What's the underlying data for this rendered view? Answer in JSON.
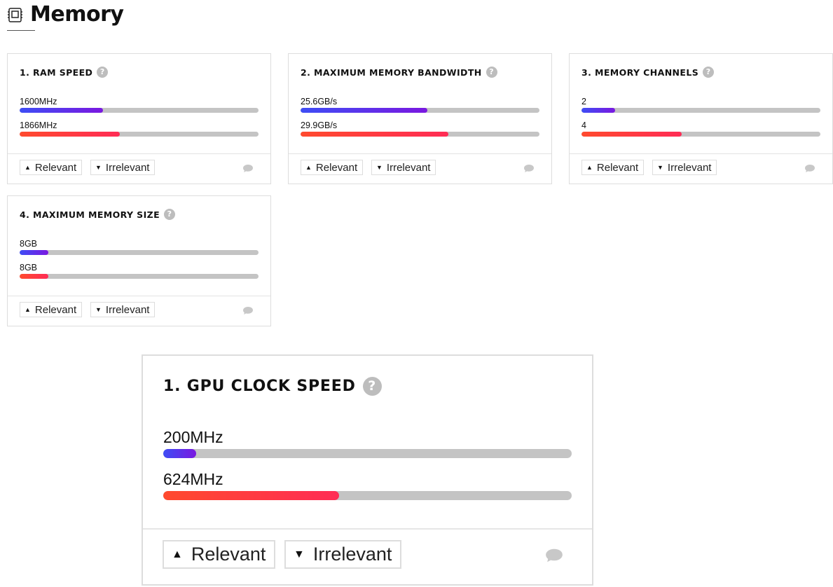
{
  "section": {
    "title": "Memory",
    "icon": "memory-chip-icon"
  },
  "cards": [
    {
      "title": "1. RAM SPEED",
      "metrics": [
        {
          "label": "1600MHz",
          "fill": 0.35,
          "color": "blue"
        },
        {
          "label": "1866MHz",
          "fill": 0.42,
          "color": "red"
        }
      ],
      "relevant_label": "Relevant",
      "irrelevant_label": "Irrelevant"
    },
    {
      "title": "2. MAXIMUM MEMORY BANDWIDTH",
      "metrics": [
        {
          "label": "25.6GB/s",
          "fill": 0.53,
          "color": "blue"
        },
        {
          "label": "29.9GB/s",
          "fill": 0.62,
          "color": "red"
        }
      ],
      "relevant_label": "Relevant",
      "irrelevant_label": "Irrelevant"
    },
    {
      "title": "3. MEMORY CHANNELS",
      "metrics": [
        {
          "label": "2",
          "fill": 0.14,
          "color": "blue"
        },
        {
          "label": "4",
          "fill": 0.42,
          "color": "red"
        }
      ],
      "relevant_label": "Relevant",
      "irrelevant_label": "Irrelevant"
    },
    {
      "title": "4. MAXIMUM MEMORY SIZE",
      "metrics": [
        {
          "label": "8GB",
          "fill": 0.12,
          "color": "blue"
        },
        {
          "label": "8GB",
          "fill": 0.12,
          "color": "red"
        }
      ],
      "relevant_label": "Relevant",
      "irrelevant_label": "Irrelevant"
    }
  ],
  "gpu_card": {
    "title": "1. GPU CLOCK SPEED",
    "metrics": [
      {
        "label": "200MHz",
        "fill": 0.08,
        "color": "blue"
      },
      {
        "label": "624MHz",
        "fill": 0.43,
        "color": "red"
      }
    ],
    "relevant_label": "Relevant",
    "irrelevant_label": "Irrelevant"
  },
  "colors": {
    "blue_start": "#3e4df5",
    "blue_end": "#7a18e0",
    "red_start": "#ff4a2e",
    "red_end": "#ff2c55",
    "track": "#c4c4c4"
  }
}
